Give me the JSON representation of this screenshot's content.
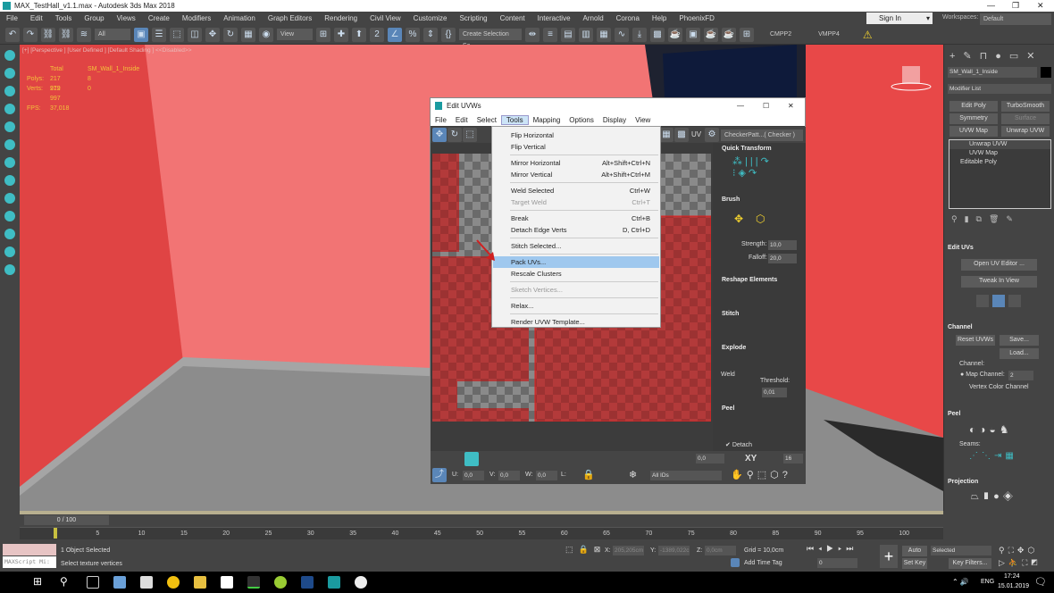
{
  "window": {
    "title": "MAX_TestHall_v1.1.max - Autodesk 3ds Max 2018",
    "min": "—",
    "restore": "❐",
    "close": "✕"
  },
  "menubar": [
    "File",
    "Edit",
    "Tools",
    "Group",
    "Views",
    "Create",
    "Modifiers",
    "Animation",
    "Graph Editors",
    "Rendering",
    "Civil View",
    "Customize",
    "Scripting",
    "Content",
    "Interactive",
    "Arnold",
    "Corona",
    "Help",
    "PhoenixFD"
  ],
  "account": {
    "sign_in": "Sign In",
    "workspaces_label": "Workspaces:",
    "workspace": "Default"
  },
  "toolbar": {
    "filter": "All",
    "ref_coord": "View",
    "selection_set": "Create Selection Se",
    "cmpp2": "CMPP2",
    "vmpp4": "VMPP4",
    "warning_icon": "warning-icon"
  },
  "viewport": {
    "label": "[+] [Perspective ] [User Defined ] [Default Shading ]  <<Disabled>>",
    "stats": {
      "total": "Total",
      "object": "SM_Wall_1_Inside",
      "polys_label": "Polys:",
      "polys_total": "217 979",
      "polys_obj": "8",
      "verts_label": "Verts:",
      "verts_total": "212 997",
      "verts_obj": "0",
      "fps_label": "FPS:",
      "fps": "37,018"
    },
    "colors": {
      "wall_dark": "#e04444",
      "wall_light": "#f27474",
      "floor": "#8c8c8c"
    }
  },
  "command_panel": {
    "object_name": "SM_Wall_1_Inside",
    "modifier_list": "Modifier List",
    "buttons": [
      "Edit Poly",
      "TurboSmooth",
      "Symmetry",
      "Surface",
      "UVW Map",
      "Unwrap UVW"
    ],
    "stack": [
      "Unwrap UVW",
      "UVW Map",
      "Editable Poly"
    ],
    "edit_uvs": {
      "title": "Edit UVs",
      "open_editor": "Open UV Editor ...",
      "tweak": "Tweak In View"
    },
    "channel": {
      "title": "Channel",
      "reset": "Reset UVWs",
      "save": "Save...",
      "load": "Load...",
      "group": "Channel:",
      "map_channel_label": "Map Channel:",
      "map_channel": "2",
      "vertex_color": "Vertex Color Channel"
    },
    "peel": {
      "title": "Peel",
      "seams": "Seams:"
    },
    "projection": {
      "title": "Projection"
    }
  },
  "uvw_editor": {
    "title": "Edit UVWs",
    "menu": [
      "File",
      "Edit",
      "Select",
      "Tools",
      "Mapping",
      "Options",
      "Display",
      "View"
    ],
    "uv_label": "UV",
    "texture": "CheckerPatt...( Checker )",
    "panels": {
      "quick_transform": "Quick Transform",
      "brush": "Brush",
      "strength_label": "Strength:",
      "strength": "10,0",
      "falloff_label": "Falloff:",
      "falloff": "20,0",
      "reshape": "Reshape Elements",
      "stitch": "Stitch",
      "explode": "Explode",
      "weld": "Weld",
      "threshold_label": "Threshold:",
      "threshold": "0,01",
      "peel": "Peel",
      "detach": "Detach"
    },
    "bottom": {
      "soft_value": "0,0",
      "xy": "XY",
      "grid_value": "16",
      "u_label": "U:",
      "u": "0,0",
      "v_label": "V:",
      "v": "0,0",
      "w_label": "W:",
      "w": "0,0",
      "l_label": "L:",
      "ids": "All IDs"
    }
  },
  "tools_menu": [
    {
      "label": "Flip Horizontal",
      "shortcut": "",
      "disabled": false
    },
    {
      "label": "Flip Vertical",
      "shortcut": "",
      "disabled": false
    },
    {
      "sep": true
    },
    {
      "label": "Mirror Horizontal",
      "shortcut": "Alt+Shift+Ctrl+N",
      "disabled": false
    },
    {
      "label": "Mirror Vertical",
      "shortcut": "Alt+Shift+Ctrl+M",
      "disabled": false
    },
    {
      "sep": true
    },
    {
      "label": "Weld Selected",
      "shortcut": "Ctrl+W",
      "disabled": false
    },
    {
      "label": "Target Weld",
      "shortcut": "Ctrl+T",
      "disabled": true
    },
    {
      "sep": true
    },
    {
      "label": "Break",
      "shortcut": "Ctrl+B",
      "disabled": false
    },
    {
      "label": "Detach Edge Verts",
      "shortcut": "D, Ctrl+D",
      "disabled": false
    },
    {
      "sep": true
    },
    {
      "label": "Stitch Selected...",
      "shortcut": "",
      "disabled": false
    },
    {
      "sep": true
    },
    {
      "label": "Pack UVs...",
      "shortcut": "",
      "disabled": false,
      "highlighted": true
    },
    {
      "label": "Rescale Clusters",
      "shortcut": "",
      "disabled": false
    },
    {
      "sep": true
    },
    {
      "label": "Sketch Vertices...",
      "shortcut": "",
      "disabled": true
    },
    {
      "sep": true
    },
    {
      "label": "Relax...",
      "shortcut": "",
      "disabled": false
    },
    {
      "sep": true
    },
    {
      "label": "Render UVW Template...",
      "shortcut": "",
      "disabled": false
    }
  ],
  "timeline": {
    "frame": "0 / 100",
    "ticks": [
      "0",
      "5",
      "10",
      "15",
      "20",
      "25",
      "30",
      "35",
      "40",
      "45",
      "50",
      "55",
      "60",
      "65",
      "70",
      "75",
      "80",
      "85",
      "90",
      "95",
      "100"
    ]
  },
  "status": {
    "selected": "1 Object Selected",
    "prompt": "Select texture vertices",
    "maxscript": "MAXScript Mi:",
    "x_label": "X:",
    "x": "205,205cm",
    "y_label": "Y:",
    "y": "-1389,022c",
    "z_label": "Z:",
    "z": "0,0cm",
    "grid": "Grid = 10,0cm",
    "add_time_tag": "Add Time Tag",
    "frame": "0",
    "auto_key": "Auto Key",
    "set_key": "Set Key",
    "key_mode": "Selected",
    "key_filters": "Key Filters..."
  },
  "taskbar": {
    "lang": "ENG",
    "time": "17:24",
    "date": "15.01.2019"
  }
}
